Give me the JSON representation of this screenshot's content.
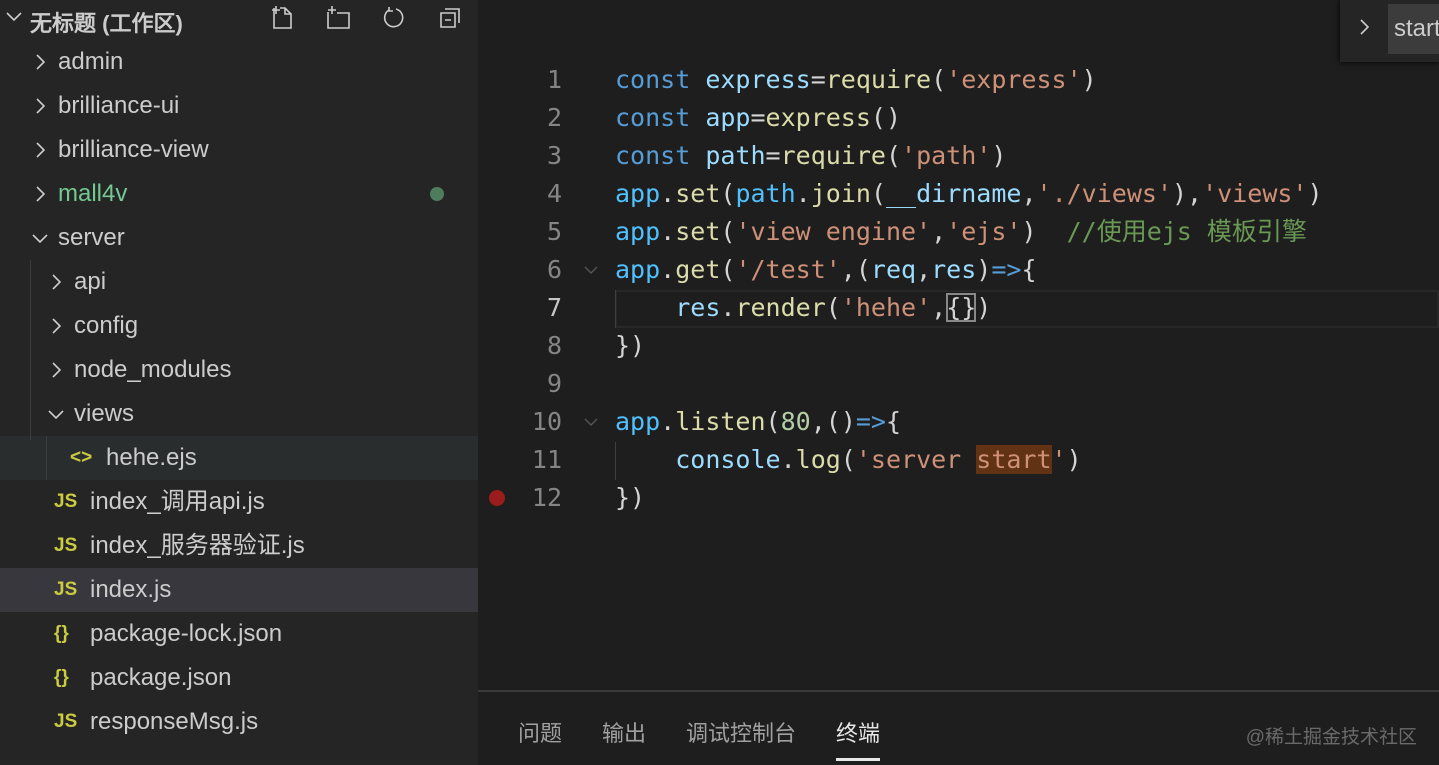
{
  "explorer": {
    "workspace_title": "无标题 (工作区)",
    "toolbar_icons": [
      "new-file-icon",
      "new-folder-icon",
      "refresh-icon",
      "collapse-all-icon"
    ],
    "items": [
      {
        "label": "admin",
        "type": "folder",
        "expanded": false,
        "depth": 0
      },
      {
        "label": "brilliance-ui",
        "type": "folder",
        "expanded": false,
        "depth": 0
      },
      {
        "label": "brilliance-view",
        "type": "folder",
        "expanded": false,
        "depth": 0
      },
      {
        "label": "mall4v",
        "type": "folder",
        "expanded": false,
        "depth": 0,
        "modified": true,
        "color": "#73c991"
      },
      {
        "label": "server",
        "type": "folder",
        "expanded": true,
        "depth": 0
      },
      {
        "label": "api",
        "type": "folder",
        "expanded": false,
        "depth": 1
      },
      {
        "label": "config",
        "type": "folder",
        "expanded": false,
        "depth": 1
      },
      {
        "label": "node_modules",
        "type": "folder",
        "expanded": false,
        "depth": 1
      },
      {
        "label": "views",
        "type": "folder",
        "expanded": true,
        "depth": 1
      },
      {
        "label": "hehe.ejs",
        "type": "ejs",
        "depth": 2,
        "icon": "<>",
        "hover": true
      },
      {
        "label": "index_调用api.js",
        "type": "js",
        "depth": 1,
        "icon": "JS"
      },
      {
        "label": "index_服务器验证.js",
        "type": "js",
        "depth": 1,
        "icon": "JS"
      },
      {
        "label": "index.js",
        "type": "js",
        "depth": 1,
        "icon": "JS",
        "selected": true
      },
      {
        "label": "package-lock.json",
        "type": "json",
        "depth": 1,
        "icon": "{}"
      },
      {
        "label": "package.json",
        "type": "json",
        "depth": 1,
        "icon": "{}"
      },
      {
        "label": "responseMsg.js",
        "type": "js",
        "depth": 1,
        "icon": "JS"
      }
    ]
  },
  "find_widget": {
    "value": "start"
  },
  "editor": {
    "current_line": 7,
    "breakpoint_line": 12,
    "lines": [
      {
        "n": "1",
        "tokens": [
          [
            "const",
            "kw"
          ],
          [
            " ",
            "p"
          ],
          [
            "express",
            "var"
          ],
          [
            "=",
            "p"
          ],
          [
            "require",
            "fn"
          ],
          [
            "(",
            "p"
          ],
          [
            "'express'",
            "str"
          ],
          [
            ")",
            "p"
          ]
        ]
      },
      {
        "n": "2",
        "tokens": [
          [
            "const",
            "kw"
          ],
          [
            " ",
            "p"
          ],
          [
            "app",
            "var"
          ],
          [
            "=",
            "p"
          ],
          [
            "express",
            "fn"
          ],
          [
            "()",
            "p"
          ]
        ]
      },
      {
        "n": "3",
        "tokens": [
          [
            "const",
            "kw"
          ],
          [
            " ",
            "p"
          ],
          [
            "path",
            "var"
          ],
          [
            "=",
            "p"
          ],
          [
            "require",
            "fn"
          ],
          [
            "(",
            "p"
          ],
          [
            "'path'",
            "str"
          ],
          [
            ")",
            "p"
          ]
        ]
      },
      {
        "n": "4",
        "tokens": [
          [
            "app",
            "obj"
          ],
          [
            ".",
            "p"
          ],
          [
            "set",
            "fn"
          ],
          [
            "(",
            "p"
          ],
          [
            "path",
            "obj"
          ],
          [
            ".",
            "p"
          ],
          [
            "join",
            "fn"
          ],
          [
            "(",
            "p"
          ],
          [
            "__dirname",
            "var"
          ],
          [
            ",",
            "p"
          ],
          [
            "'./views'",
            "str"
          ],
          [
            "),",
            "p"
          ],
          [
            "'views'",
            "str"
          ],
          [
            ")",
            "p"
          ]
        ]
      },
      {
        "n": "5",
        "tokens": [
          [
            "app",
            "obj"
          ],
          [
            ".",
            "p"
          ],
          [
            "set",
            "fn"
          ],
          [
            "(",
            "p"
          ],
          [
            "'view engine'",
            "str"
          ],
          [
            ",",
            "p"
          ],
          [
            "'ejs'",
            "str"
          ],
          [
            ")  ",
            "p"
          ],
          [
            "//使用ejs 模板引擎",
            "cm"
          ]
        ]
      },
      {
        "n": "6",
        "fold": true,
        "tokens": [
          [
            "app",
            "obj"
          ],
          [
            ".",
            "p"
          ],
          [
            "get",
            "fn"
          ],
          [
            "(",
            "p"
          ],
          [
            "'/test'",
            "str"
          ],
          [
            ",(",
            "p"
          ],
          [
            "req",
            "var"
          ],
          [
            ",",
            "p"
          ],
          [
            "res",
            "var"
          ],
          [
            ")",
            "p"
          ],
          [
            "=>",
            "kw"
          ],
          [
            "{",
            "p"
          ]
        ]
      },
      {
        "n": "7",
        "tokens": [
          [
            "    ",
            "p"
          ],
          [
            "res",
            "var"
          ],
          [
            ".",
            "p"
          ],
          [
            "render",
            "fn"
          ],
          [
            "(",
            "p"
          ],
          [
            "'hehe'",
            "str"
          ],
          [
            ",",
            "p"
          ],
          [
            "{}",
            "box"
          ],
          [
            ")",
            "p"
          ]
        ]
      },
      {
        "n": "8",
        "tokens": [
          [
            "})",
            "p"
          ]
        ]
      },
      {
        "n": "9",
        "tokens": []
      },
      {
        "n": "10",
        "fold": true,
        "tokens": [
          [
            "app",
            "obj"
          ],
          [
            ".",
            "p"
          ],
          [
            "listen",
            "fn"
          ],
          [
            "(",
            "p"
          ],
          [
            "80",
            "num"
          ],
          [
            ",",
            "p"
          ],
          [
            "()",
            "p"
          ],
          [
            "=>",
            "kw"
          ],
          [
            "{",
            "p"
          ]
        ]
      },
      {
        "n": "11",
        "tokens": [
          [
            "    ",
            "p"
          ],
          [
            "console",
            "var"
          ],
          [
            ".",
            "p"
          ],
          [
            "log",
            "fn"
          ],
          [
            "(",
            "p"
          ],
          [
            "'server ",
            "str"
          ],
          [
            "start",
            "strhl"
          ],
          [
            "'",
            "str"
          ],
          [
            ")",
            "p"
          ]
        ]
      },
      {
        "n": "12",
        "tokens": [
          [
            "})",
            "p"
          ]
        ]
      }
    ]
  },
  "panel": {
    "tabs": [
      {
        "label": "问题"
      },
      {
        "label": "输出"
      },
      {
        "label": "调试控制台"
      },
      {
        "label": "终端",
        "active": true
      }
    ],
    "watermark": "@稀土掘金技术社区"
  }
}
